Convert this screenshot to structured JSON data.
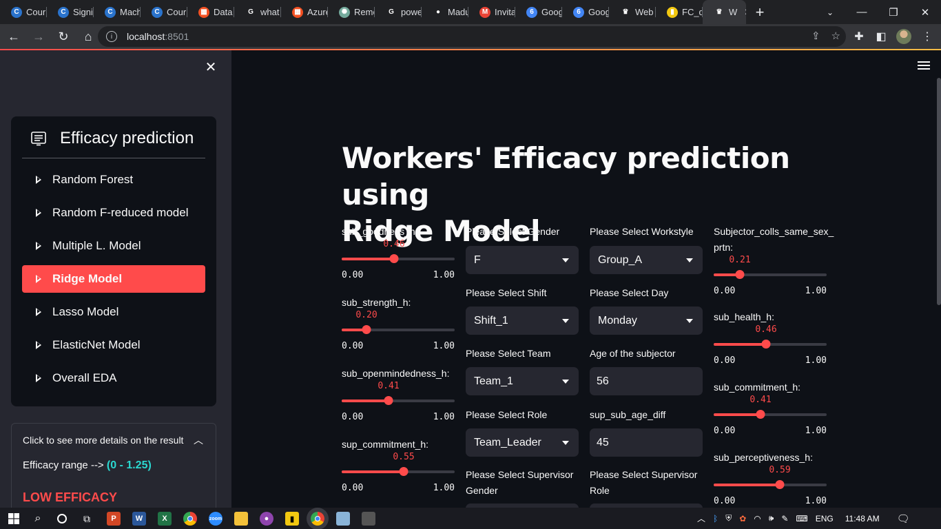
{
  "browser": {
    "tabs": [
      {
        "label": "Cour",
        "icon": "coursera-icon",
        "color": "#2a73cc",
        "glyph": "C"
      },
      {
        "label": "Signi",
        "icon": "coursera-icon",
        "color": "#2a73cc",
        "glyph": "C"
      },
      {
        "label": "Mach",
        "icon": "coursera-icon",
        "color": "#2a73cc",
        "glyph": "C"
      },
      {
        "label": "Cour",
        "icon": "coursera-icon",
        "color": "#2a73cc",
        "glyph": "C"
      },
      {
        "label": "Data",
        "icon": "microsoft-icon",
        "color": "#f25022",
        "glyph": "▦"
      },
      {
        "label": "what",
        "icon": "google-icon",
        "color": "#ffffff",
        "glyph": "G"
      },
      {
        "label": "Azure",
        "icon": "microsoft-icon",
        "color": "#f25022",
        "glyph": "▦"
      },
      {
        "label": "Remo",
        "icon": "chatgpt-icon",
        "color": "#74aa9c",
        "glyph": "✺"
      },
      {
        "label": "powe",
        "icon": "google-icon",
        "color": "#ffffff",
        "glyph": "G"
      },
      {
        "label": "Madu",
        "icon": "github-icon",
        "color": "#ffffff",
        "glyph": "●"
      },
      {
        "label": "Invita",
        "icon": "gmail-icon",
        "color": "#ea4335",
        "glyph": "M"
      },
      {
        "label": "Goog",
        "icon": "google-calendar-icon",
        "color": "#4285f4",
        "glyph": "6"
      },
      {
        "label": "Goog",
        "icon": "google-calendar-icon",
        "color": "#4285f4",
        "glyph": "6"
      },
      {
        "label": "Web",
        "icon": "streamlit-icon",
        "color": "#ffffff",
        "glyph": "♛"
      },
      {
        "label": "FC_d",
        "icon": "powerbi-icon",
        "color": "#f2c811",
        "glyph": "▮"
      }
    ],
    "active_tab": {
      "label": "W",
      "icon": "streamlit-icon",
      "glyph": "♛"
    },
    "url_host": "localhost",
    "url_port": ":8501"
  },
  "sidebar": {
    "menu_title": "Efficacy prediction",
    "items": [
      {
        "label": "Random Forest",
        "active": false
      },
      {
        "label": "Random F-reduced model",
        "active": false
      },
      {
        "label": "Multiple L. Model",
        "active": false
      },
      {
        "label": "Ridge Model",
        "active": true
      },
      {
        "label": "Lasso Model",
        "active": false
      },
      {
        "label": "ElasticNet Model",
        "active": false
      },
      {
        "label": "Overall EDA",
        "active": false
      }
    ],
    "expander": {
      "header": "Click to see more details on the result",
      "range_prefix": "Efficacy range -->",
      "range_value": "(0 - 1.25)",
      "result": "LOW EFFICACY"
    }
  },
  "main": {
    "title_line1": "Workers' Efficacy prediction using",
    "title_line2": "Ridge Model",
    "sliders_col1": [
      {
        "label": "sub_goodness_h:",
        "value": "0.46",
        "fraction": 0.46,
        "min": "0.00",
        "max": "1.00"
      },
      {
        "label": "sub_strength_h:",
        "value": "0.20",
        "fraction": 0.2,
        "min": "0.00",
        "max": "1.00"
      },
      {
        "label": "sub_openmindedness_h:",
        "value": "0.41",
        "fraction": 0.41,
        "min": "0.00",
        "max": "1.00"
      },
      {
        "label": "sup_commitment_h:",
        "value": "0.55",
        "fraction": 0.55,
        "min": "0.00",
        "max": "1.00"
      }
    ],
    "selects_col2": [
      {
        "label": "Please Select Gender",
        "value": "F"
      },
      {
        "label": "Please Select Shift",
        "value": "Shift_1"
      },
      {
        "label": "Please Select Team",
        "value": "Team_1"
      },
      {
        "label": "Please Select Role",
        "value": "Team_Leader"
      },
      {
        "label_line1": "Please Select Supervisor",
        "label_line2": "Gender"
      }
    ],
    "col3": {
      "workstyle": {
        "label": "Please Select Workstyle",
        "value": "Group_A"
      },
      "day": {
        "label": "Please Select Day",
        "value": "Monday"
      },
      "age": {
        "label": "Age of the subjector",
        "value": "56"
      },
      "age_diff": {
        "label": "sup_sub_age_diff",
        "value": "45"
      },
      "sup_role": {
        "label_line1": "Please Select Supervisor",
        "label_line2": "Role"
      }
    },
    "sliders_col4": [
      {
        "label_line1": "Subjector_colls_same_sex_",
        "label_line2": "prtn:",
        "value": "0.21",
        "fraction": 0.21,
        "min": "0.00",
        "max": "1.00"
      },
      {
        "label": "sub_health_h:",
        "value": "0.46",
        "fraction": 0.46,
        "min": "0.00",
        "max": "1.00"
      },
      {
        "label": "sub_commitment_h:",
        "value": "0.41",
        "fraction": 0.41,
        "min": "0.00",
        "max": "1.00"
      },
      {
        "label": "sub_perceptiveness_h:",
        "value": "0.59",
        "fraction": 0.59,
        "min": "0.00",
        "max": "1.00"
      }
    ]
  },
  "taskbar": {
    "language": "ENG",
    "time": "11:48 AM"
  },
  "colors": {
    "accent": "#ff4b4b",
    "teal": "#2bd9d1",
    "background": "#0e1117",
    "sidebar": "#262730"
  }
}
